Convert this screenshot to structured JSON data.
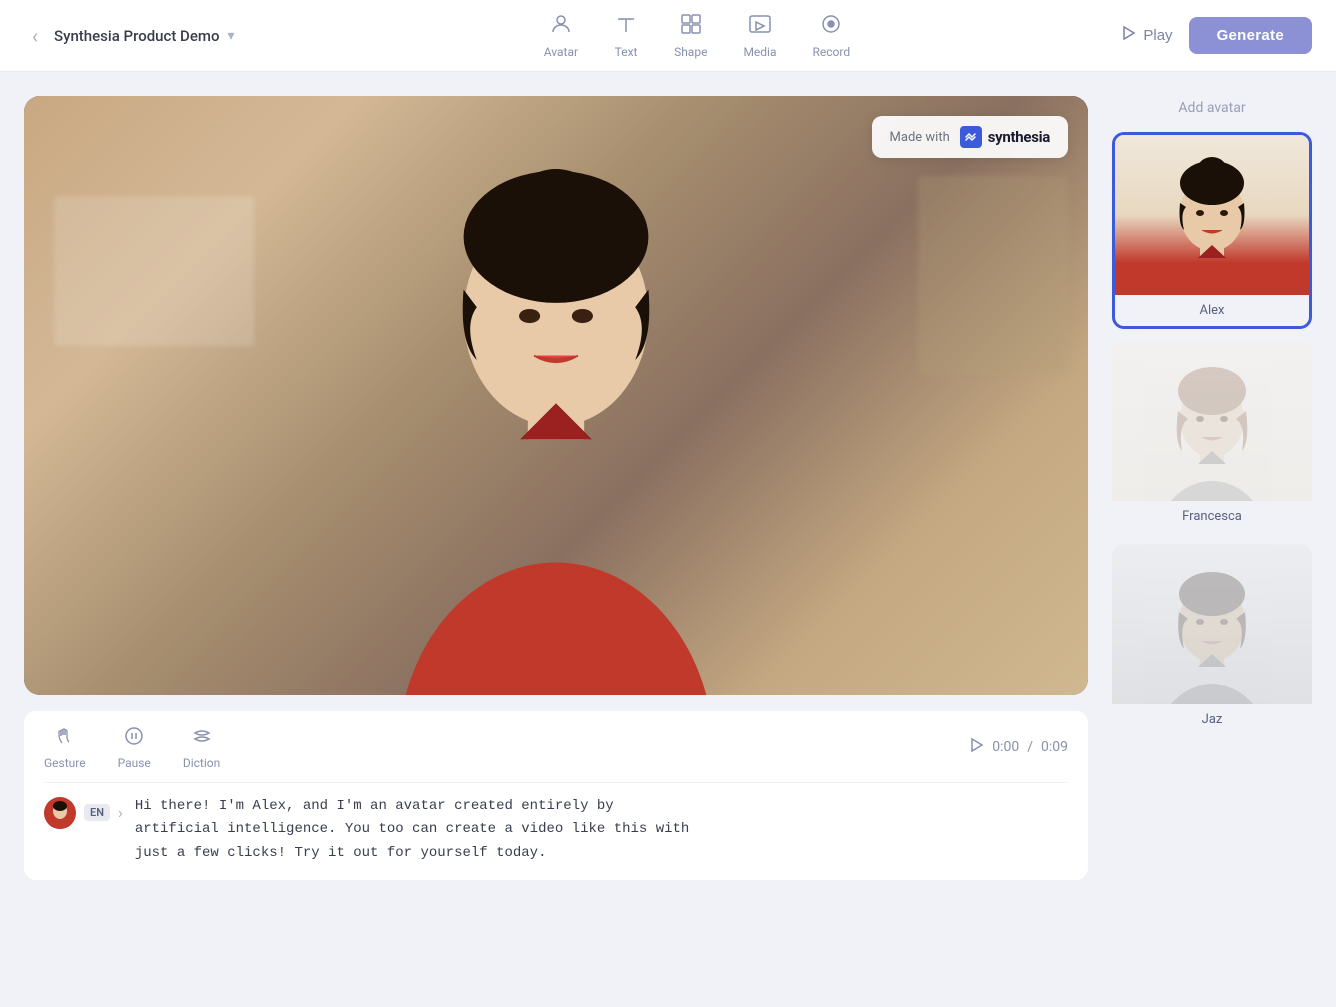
{
  "navbar": {
    "back_label": "‹",
    "title": "Synthesia Product Demo",
    "chevron": "▾",
    "tools": [
      {
        "id": "avatar",
        "icon": "👤",
        "label": "Avatar"
      },
      {
        "id": "text",
        "icon": "T",
        "label": "Text"
      },
      {
        "id": "shape",
        "icon": "⬡",
        "label": "Shape"
      },
      {
        "id": "media",
        "icon": "▦",
        "label": "Media"
      },
      {
        "id": "record",
        "icon": "⏺",
        "label": "Record"
      }
    ],
    "play_label": "Play",
    "generate_label": "Generate"
  },
  "watermark": {
    "made_with": "Made with",
    "brand_name": "synthesia"
  },
  "controls": {
    "gesture_label": "Gesture",
    "pause_label": "Pause",
    "diction_label": "Diction",
    "time_current": "0:00",
    "time_separator": "/",
    "time_total": "0:09"
  },
  "script": {
    "lang_badge": "EN",
    "text": "Hi there! I'm Alex, and I'm an avatar created entirely by\nartificial intelligence. You too can create a video like this with\njust a few clicks! Try it out for yourself today."
  },
  "sidebar": {
    "add_avatar_title": "Add avatar",
    "avatars": [
      {
        "id": "alex",
        "name": "Alex",
        "selected": true
      },
      {
        "id": "francesca",
        "name": "Francesca",
        "selected": false
      },
      {
        "id": "jaz",
        "name": "Jaz",
        "selected": false
      }
    ]
  },
  "colors": {
    "accent_blue": "#3b5bdb",
    "generate_btn": "#8b91d4",
    "avatar_red": "#c0392b"
  }
}
